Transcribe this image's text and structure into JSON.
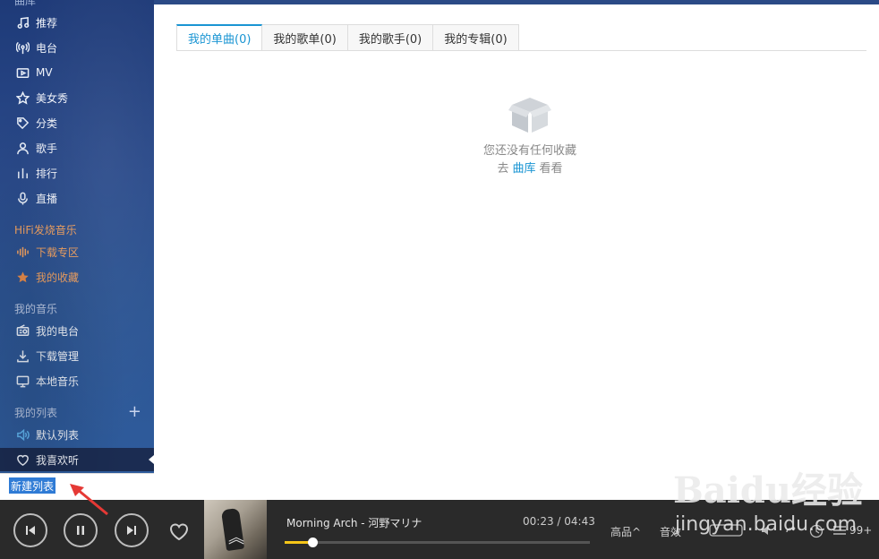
{
  "sidebar": {
    "top_cut": "曲库",
    "online": [
      {
        "label": "推荐",
        "icon": "music-note-icon"
      },
      {
        "label": "电台",
        "icon": "radio-tower-icon"
      },
      {
        "label": "MV",
        "icon": "video-icon"
      },
      {
        "label": "美女秀",
        "icon": "star-outline-icon"
      },
      {
        "label": "分类",
        "icon": "tag-icon"
      },
      {
        "label": "歌手",
        "icon": "person-icon"
      },
      {
        "label": "排行",
        "icon": "bars-icon"
      },
      {
        "label": "直播",
        "icon": "microphone-icon"
      }
    ],
    "hifi_header": "HiFi发烧音乐",
    "hifi": [
      {
        "label": "下载专区",
        "icon": "waveform-icon"
      },
      {
        "label": "我的收藏",
        "icon": "star-filled-icon"
      }
    ],
    "mymusic_header": "我的音乐",
    "mymusic": [
      {
        "label": "我的电台",
        "icon": "radio-icon"
      },
      {
        "label": "下载管理",
        "icon": "download-icon"
      },
      {
        "label": "本地音乐",
        "icon": "monitor-icon"
      }
    ],
    "mylists_header": "我的列表",
    "mylists_add": "+",
    "mylists": [
      {
        "label": "默认列表",
        "icon": "speaker-icon"
      },
      {
        "label": "我喜欢听",
        "icon": "heart-icon"
      }
    ],
    "new_list_value": "新建列表"
  },
  "main": {
    "tabs": [
      {
        "label": "我的单曲(0)",
        "active": true
      },
      {
        "label": "我的歌单(0)",
        "active": false
      },
      {
        "label": "我的歌手(0)",
        "active": false
      },
      {
        "label": "我的专辑(0)",
        "active": false
      }
    ],
    "empty_message": "您还没有任何收藏",
    "empty_go_prefix": "去",
    "empty_go_link": "曲库",
    "empty_go_suffix": "看看"
  },
  "player": {
    "song": "Morning Arch - 河野マリナ",
    "elapsed": "00:23",
    "duration": "04:43",
    "progress": 0.09,
    "quality": "高品^",
    "effect": "音效",
    "count": "99+",
    "accent_color": "#f5c518"
  },
  "watermark": {
    "logo": "Baidu经验",
    "site": "jingyan.baidu.com"
  },
  "colors": {
    "tab_active": "#1a95d3",
    "sidebar_bg": "#2a4a8a",
    "player_bg": "#2a2a2a",
    "annotation": "#e53935"
  }
}
